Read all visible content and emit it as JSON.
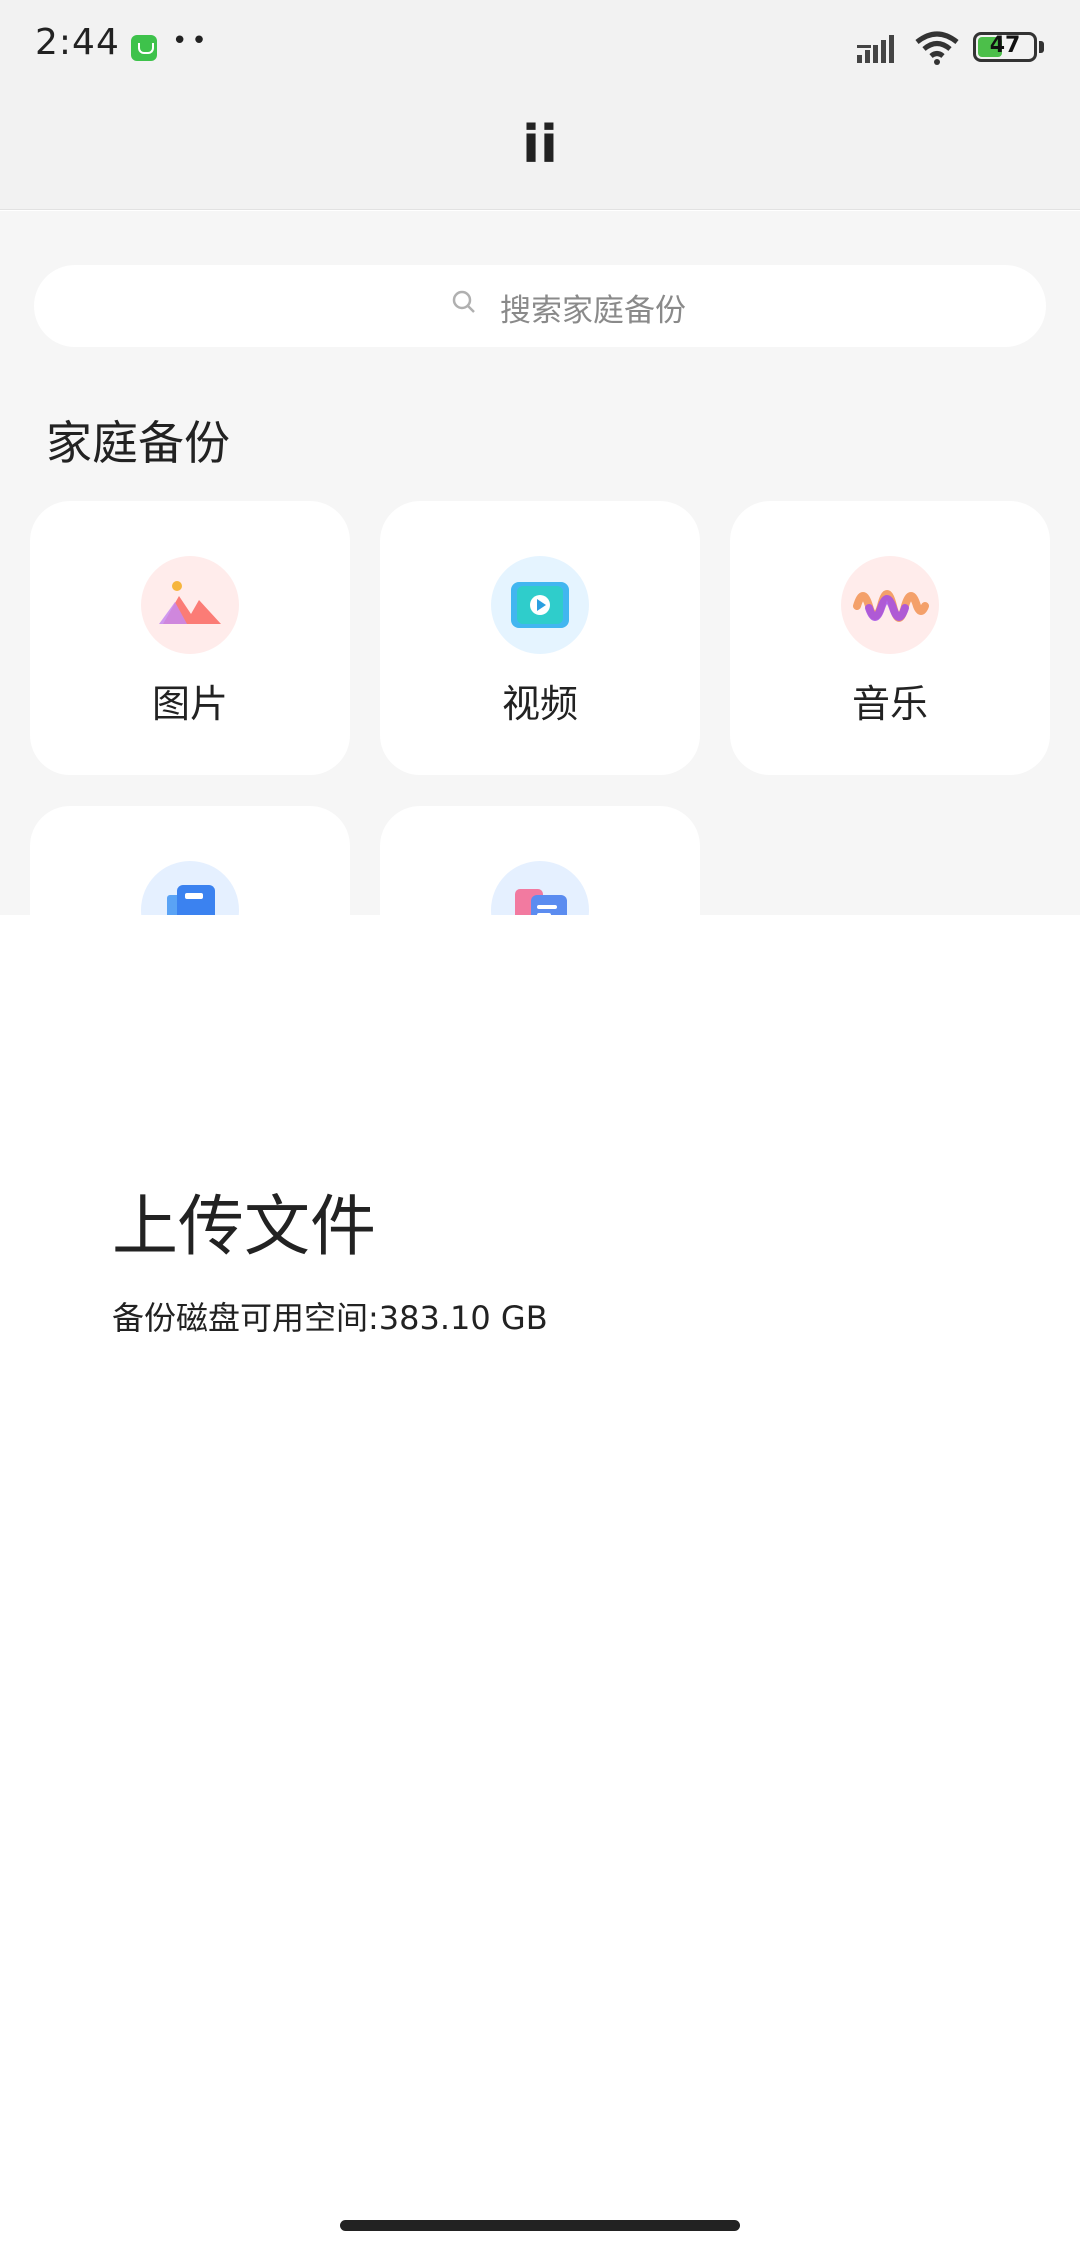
{
  "status_bar": {
    "time": "2:44",
    "dots": "••",
    "battery_level": "47"
  },
  "app_bar": {
    "title": "ii"
  },
  "search": {
    "placeholder": "搜索家庭备份"
  },
  "section": {
    "title": "家庭备份"
  },
  "categories": [
    {
      "label": "图片",
      "icon": "image-icon"
    },
    {
      "label": "视频",
      "icon": "video-icon"
    },
    {
      "label": "音乐",
      "icon": "music-icon"
    },
    {
      "label": "",
      "icon": "document-icon"
    },
    {
      "label": "",
      "icon": "file-icon"
    }
  ],
  "sheet": {
    "title": "上传文件",
    "info": "备份磁盘可用空间:383.10 GB"
  }
}
